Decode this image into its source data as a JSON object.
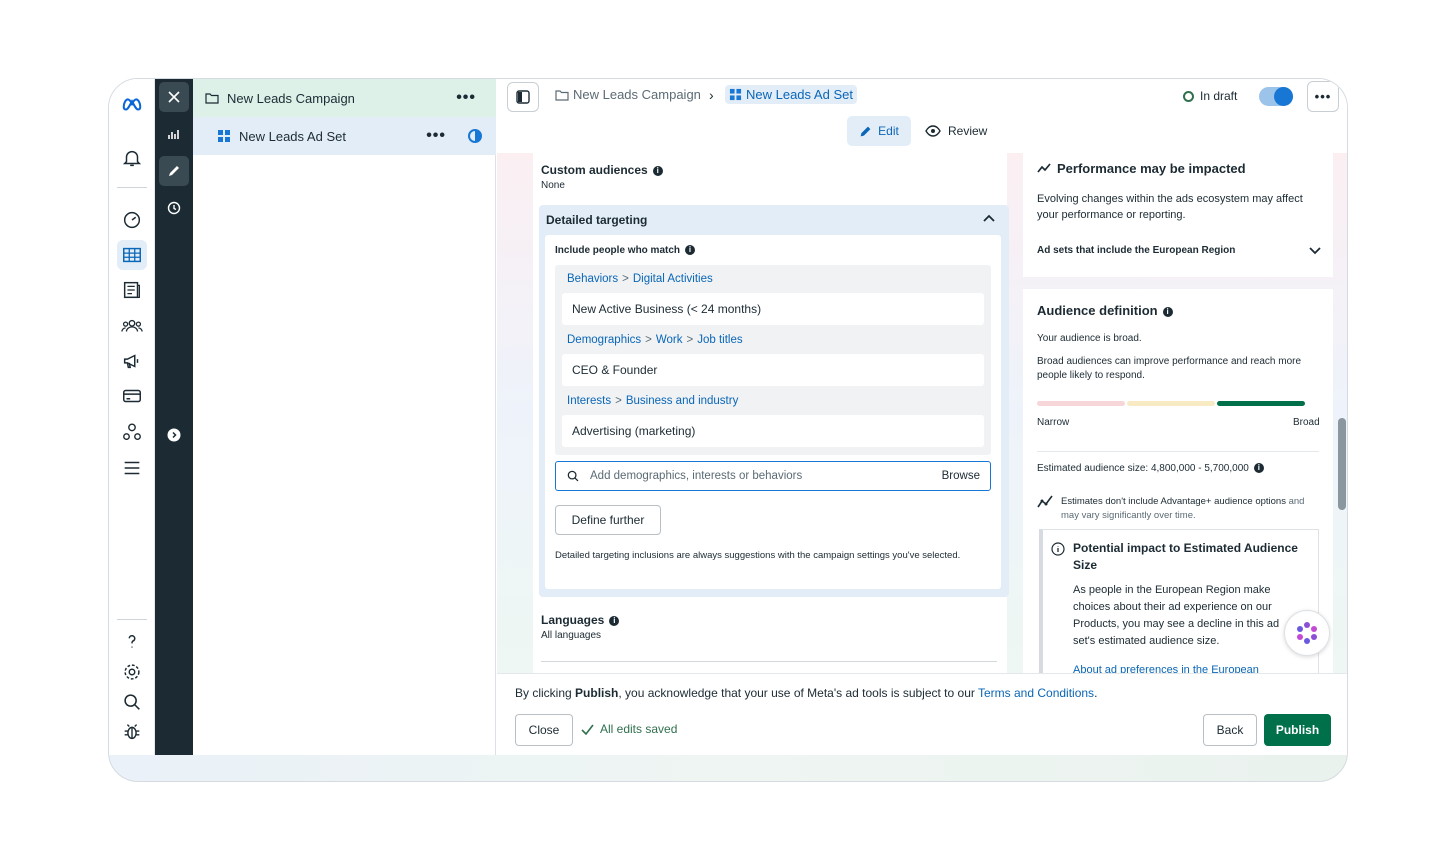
{
  "tree": {
    "campaign_label": "New Leads Campaign",
    "adset_label": "New Leads Ad Set"
  },
  "topbar": {
    "breadcrumb_campaign": "New Leads Campaign",
    "breadcrumb_adset": "New Leads Ad Set",
    "status": "In draft",
    "tab_edit": "Edit",
    "tab_review": "Review"
  },
  "custom_audiences": {
    "title": "Custom audiences",
    "value": "None"
  },
  "detailed_targeting": {
    "title": "Detailed targeting",
    "include_label": "Include people who match",
    "groups": [
      {
        "path": [
          "Behaviors",
          "Digital Activities"
        ],
        "item": "New Active Business (< 24 months)"
      },
      {
        "path": [
          "Demographics",
          "Work",
          "Job titles"
        ],
        "item": "CEO & Founder"
      },
      {
        "path": [
          "Interests",
          "Business and industry"
        ],
        "item": "Advertising (marketing)"
      }
    ],
    "search_placeholder": "Add demographics, interests or behaviors",
    "browse_label": "Browse",
    "define_further_label": "Define further",
    "note": "Detailed targeting inclusions are always suggestions with the campaign settings you've selected."
  },
  "languages": {
    "title": "Languages",
    "value": "All languages"
  },
  "performance": {
    "title": "Performance may be impacted",
    "text": "Evolving changes within the ads ecosystem may affect your performance or reporting.",
    "dropdown": "Ad sets that include the European Region"
  },
  "audience": {
    "title": "Audience definition",
    "broad_text": "Your audience is broad.",
    "desc": "Broad audiences can improve performance and reach more people likely to respond.",
    "narrow_label": "Narrow",
    "broad_label": "Broad",
    "level": "broad",
    "estimated": "Estimated audience size: 4,800,000 - 5,700,000",
    "estimates_note_link": "Estimates don't include Advantage+ audience options",
    "estimates_note_rest": "and may vary significantly over time.",
    "impact_title": "Potential impact to Estimated Audience Size",
    "impact_text": "As people in the European Region make choices about their ad experience on our Products, you may see a decline in this ad set's estimated audience size.",
    "impact_link": "About ad preferences in the European"
  },
  "footer": {
    "terms_prefix": "By clicking",
    "terms_bold": "Publish",
    "terms_middle": ", you acknowledge that your use of Meta's ad tools is subject to our",
    "terms_link": "Terms and Conditions",
    "terms_end": ".",
    "close_label": "Close",
    "saved_label": "All edits saved",
    "back_label": "Back",
    "publish_label": "Publish"
  },
  "colors": {
    "accent": "#1877d4",
    "link": "#0a66b7",
    "dark_rail": "#1c2b33",
    "publish": "#00704a",
    "bar_narrow": "#f7d6da",
    "bar_mid": "#f8ebc4",
    "bar_broad": "#00704a"
  }
}
